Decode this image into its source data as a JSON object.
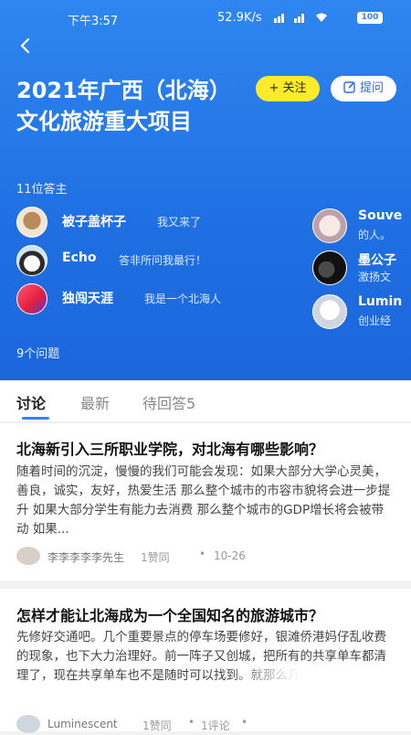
{
  "status": {
    "time": "下午3:57",
    "speed": "52.9K/s",
    "battery": "100"
  },
  "topic": {
    "title": "2021年广西（北海）文化旅游重大项目",
    "follow_label": "+ 关注",
    "ask_label": "提问",
    "answerer_count": "11位答主",
    "question_count": "9个问题"
  },
  "answerers_left": [
    {
      "name": "被子盖杯子",
      "bio": "我又来了"
    },
    {
      "name": "Echo",
      "bio": "答非所问我最行！"
    },
    {
      "name": "独闯天涯",
      "bio": "我是一个北海人"
    }
  ],
  "answerers_right": [
    {
      "name": "Souve",
      "bio": "的人。"
    },
    {
      "name": "墨公子",
      "bio": "激扬文"
    },
    {
      "name": "Lumin",
      "bio": "创业经"
    }
  ],
  "tabs": [
    {
      "label": "讨论"
    },
    {
      "label": "最新"
    },
    {
      "label": "待回答5"
    }
  ],
  "questions": [
    {
      "title": "北海新引入三所职业学院，对北海有哪些影响？",
      "excerpt": "随着时间的沉淀，慢慢的我们可能会发现：如果大部分大学心灵美，善良，诚实，友好，热爱生活 那么整个城市的市容市貌将会进一步提升 如果大部分学生有能力去消费 那么整个城市的GDP增长将会被带动 如果...",
      "author": "李李李李李先生",
      "likes": "1赞同",
      "date": "10-26"
    },
    {
      "title": "怎样才能让北海成为一个全国知名的旅游城市？",
      "excerpt": "先修好交通吧。几个重要景点的停车场要修好，银滩侨港妈仔乱收费的现象，也下大力治理好。前一阵子又创城，把所有的共享单车都清理了，现在共享单车也不是随时可以找到。就那么几个点",
      "author": "Luminescent",
      "likes": "1赞同",
      "comments": "1评论"
    }
  ],
  "colors": {
    "hero_blue": "#2f86f0",
    "follow_yellow": "#ffea2b",
    "tab_accent": "#2f86f0"
  }
}
